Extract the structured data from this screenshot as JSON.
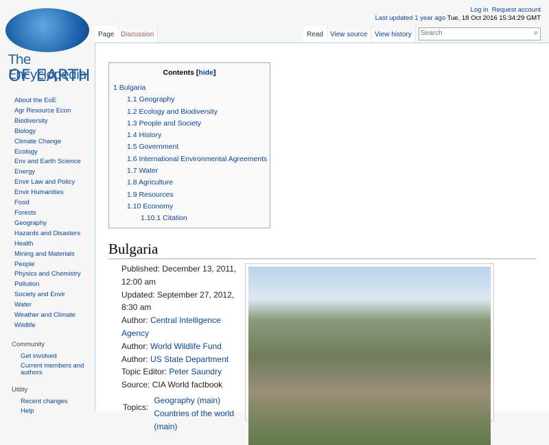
{
  "logo": {
    "line1": "The Encyclopedia",
    "line2": "OF EARTH"
  },
  "personal": {
    "login": "Log in",
    "request": "Request account",
    "updated_label": "Last updated 1 year ago",
    "updated_date": "Tue, 18 Oct 2016 15:34:29 GMT"
  },
  "tabs": {
    "page": "Page",
    "discussion": "Discussion",
    "read": "Read",
    "view_source": "View source",
    "view_history": "View history"
  },
  "search": {
    "placeholder": "Search"
  },
  "sidebar": {
    "items": [
      "About the EoE",
      "Agr Resource Econ",
      "Biodiversity",
      "Biology",
      "Climate Change",
      "Ecology",
      "Env and Earth Science",
      "Energy",
      "Envir Law and Policy",
      "Envir Humanities",
      "Food",
      "Forests",
      "Geography",
      "Hazards and Disasters",
      "Health",
      "Mining and Materials",
      "People",
      "Physics and Chemistry",
      "Pollution",
      "Society and Envir",
      "Water",
      "Weather and Climate",
      "Wildlife"
    ],
    "community_heading": "Community",
    "community": [
      "Get involved",
      "Current members and authors"
    ],
    "utility_heading": "Utility",
    "utility": [
      "Recent changes",
      "Help"
    ]
  },
  "toc": {
    "title": "Contents",
    "hide": "hide",
    "items": [
      {
        "num": "1",
        "text": "Bulgaria",
        "level": 1
      },
      {
        "num": "1.1",
        "text": "Geography",
        "level": 2
      },
      {
        "num": "1.2",
        "text": "Ecology and Biodiversity",
        "level": 2
      },
      {
        "num": "1.3",
        "text": "People and Society",
        "level": 2
      },
      {
        "num": "1.4",
        "text": "History",
        "level": 2
      },
      {
        "num": "1.5",
        "text": "Government",
        "level": 2
      },
      {
        "num": "1.6",
        "text": "International Environmental Agreements",
        "level": 2
      },
      {
        "num": "1.7",
        "text": "Water",
        "level": 2
      },
      {
        "num": "1.8",
        "text": "Agriculture",
        "level": 2
      },
      {
        "num": "1.9",
        "text": "Resources",
        "level": 2
      },
      {
        "num": "1.10",
        "text": "Economy",
        "level": 2
      },
      {
        "num": "1.10.1",
        "text": "Citation",
        "level": 3
      }
    ]
  },
  "heading": "Bulgaria",
  "meta": {
    "published": "Published: December 13, 2011, 12:00 am",
    "updated": "Updated: September 27, 2012, 8:30 am",
    "author_label": "Author:",
    "authors": [
      "Central Intelligence Agency",
      "World Wildlife Fund",
      "US State Department"
    ],
    "editor_label": "Topic Editor:",
    "editor": "Peter Saundry",
    "source": "Source: CIA World factbook",
    "topics_label": "Topics:",
    "topics": [
      "Geography (main)",
      "Countries of the world (main)"
    ]
  }
}
